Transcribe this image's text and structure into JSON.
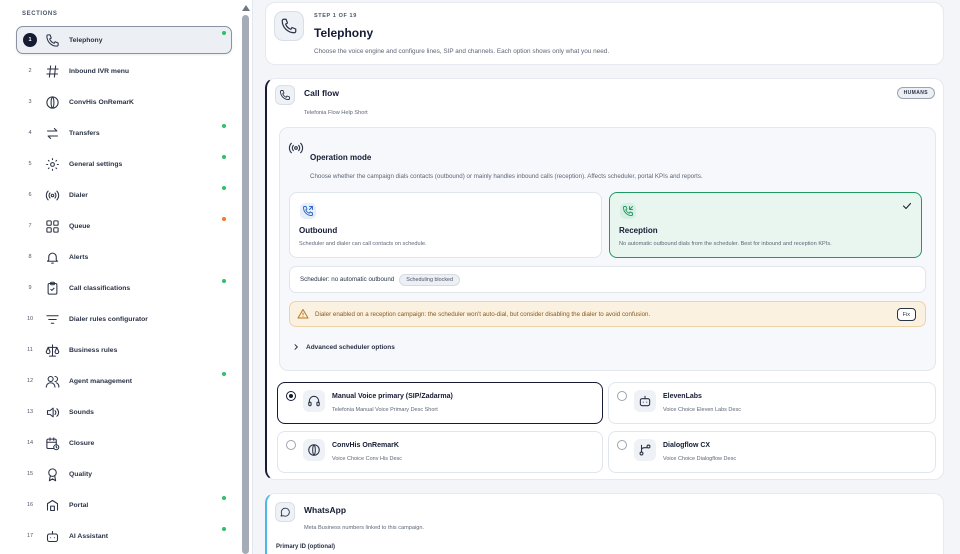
{
  "sidebar": {
    "title": "SECTIONS",
    "items": [
      {
        "num": "1",
        "label": "Telephony",
        "icon": "phone-icon",
        "dot": "#2fbf6a",
        "active": true
      },
      {
        "num": "2",
        "label": "Inbound IVR menu",
        "icon": "hash-icon",
        "dot": null
      },
      {
        "num": "3",
        "label": "ConvHis OnRemarK",
        "icon": "circle-split-icon",
        "dot": null
      },
      {
        "num": "4",
        "label": "Transfers",
        "icon": "transfer-arrows-icon",
        "dot": "#2fbf6a"
      },
      {
        "num": "5",
        "label": "General settings",
        "icon": "gear-icon",
        "dot": "#2fbf6a"
      },
      {
        "num": "6",
        "label": "Dialer",
        "icon": "broadcast-icon",
        "dot": "#2fbf6a"
      },
      {
        "num": "7",
        "label": "Queue",
        "icon": "grid-icon",
        "dot": "#f07a2a"
      },
      {
        "num": "8",
        "label": "Alerts",
        "icon": "bell-icon",
        "dot": null
      },
      {
        "num": "9",
        "label": "Call classifications",
        "icon": "clipboard-check-icon",
        "dot": "#2fbf6a"
      },
      {
        "num": "10",
        "label": "Dialer rules configurator",
        "icon": "filter-lines-icon",
        "dot": null
      },
      {
        "num": "11",
        "label": "Business rules",
        "icon": "scales-icon",
        "dot": null
      },
      {
        "num": "12",
        "label": "Agent management",
        "icon": "users-icon",
        "dot": "#2fbf6a"
      },
      {
        "num": "13",
        "label": "Sounds",
        "icon": "speaker-icon",
        "dot": null
      },
      {
        "num": "14",
        "label": "Closure",
        "icon": "calendar-clock-icon",
        "dot": null
      },
      {
        "num": "15",
        "label": "Quality",
        "icon": "award-icon",
        "dot": null
      },
      {
        "num": "16",
        "label": "Portal",
        "icon": "portal-icon",
        "dot": "#2fbf6a"
      },
      {
        "num": "17",
        "label": "AI Assistant",
        "icon": "bot-icon",
        "dot": "#2fbf6a"
      }
    ]
  },
  "header": {
    "step": "STEP 1 OF 19",
    "title": "Telephony",
    "description": "Choose the voice engine and configure lines, SIP and channels. Each option shows only what you need."
  },
  "call_flow": {
    "title": "Call flow",
    "subtitle": "Telefonia Flow Help Short",
    "badge": "HUMANS",
    "operation_mode": {
      "title": "Operation mode",
      "description": "Choose whether the campaign dials contacts (outbound) or mainly handles inbound calls (reception). Affects scheduler, portal KPIs and reports.",
      "outbound": {
        "title": "Outbound",
        "description": "Scheduler and dialer can call contacts on schedule."
      },
      "reception": {
        "title": "Reception",
        "description": "No automatic outbound dials from the scheduler. Best for inbound and reception KPIs.",
        "selected": true
      }
    },
    "scheduler": {
      "label": "Scheduler: no automatic outbound",
      "pill": "Scheduling blocked"
    },
    "warning": {
      "text": "Dialer enabled on a reception campaign: the scheduler won't auto-dial, but consider disabling the dialer to avoid confusion.",
      "fix_label": "Fix"
    },
    "advanced_label": "Advanced scheduler options",
    "engines": [
      {
        "title": "Manual Voice primary (SIP/Zadarma)",
        "description": "Telefonia Manual Voice Primary Desc Short",
        "icon": "headset-icon",
        "selected": true
      },
      {
        "title": "ElevenLabs",
        "description": "Voice Choice Eleven Labs Desc",
        "icon": "bot-icon",
        "selected": false
      },
      {
        "title": "ConvHis OnRemarK",
        "description": "Voice Choice Conv His Desc",
        "icon": "circle-split-icon",
        "selected": false
      },
      {
        "title": "Dialogflow CX",
        "description": "Voice Choice Dialogflow Desc",
        "icon": "flow-branch-icon",
        "selected": false
      }
    ]
  },
  "whatsapp": {
    "title": "WhatsApp",
    "subtitle": "Meta Business numbers linked to this campaign.",
    "field_label": "Primary ID (optional)"
  },
  "colors": {
    "accent": "#141b33",
    "success": "#1f9a63",
    "warning": "#b8731a",
    "whatsapp_accent": "#4fb7e8"
  }
}
